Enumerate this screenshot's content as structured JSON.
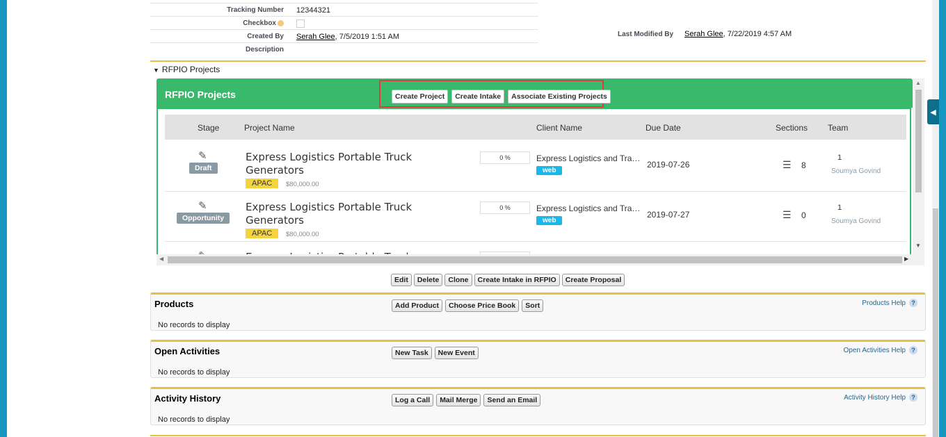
{
  "detail": {
    "tracking_label": "Tracking Number",
    "tracking_value": "12344321",
    "checkbox_label": "Checkbox",
    "created_by_label": "Created By",
    "created_by_user": "Serah Glee",
    "created_by_date": ", 7/5/2019 1:51 AM",
    "description_label": "Description",
    "last_modified_label": "Last Modified By",
    "last_modified_user": "Serah Glee",
    "last_modified_date": ", 7/22/2019 4:57 AM"
  },
  "rfpio_section": {
    "toggle_label": "RFPIO Projects",
    "panel_title": "RFPIO Projects",
    "buttons": [
      "Create Project",
      "Create Intake",
      "Associate Existing Projects"
    ],
    "columns": [
      "Stage",
      "Project Name",
      "Client Name",
      "Due Date",
      "Sections",
      "Team"
    ],
    "rows": [
      {
        "stage": "Draft",
        "project_name": "Express Logistics Portable Truck Generators",
        "region": "APAC",
        "amount": "$80,000.00",
        "progress": "0 %",
        "client": "Express Logistics and Transport",
        "client_tag": "web",
        "due_date": "2019-07-26",
        "sections": "8",
        "team_count": "1",
        "team_member": "Soumya Govind"
      },
      {
        "stage": "Opportunity",
        "project_name": "Express Logistics Portable Truck Generators",
        "region": "APAC",
        "amount": "$80,000.00",
        "progress": "0 %",
        "client": "Express Logistics and Transport",
        "client_tag": "web",
        "due_date": "2019-07-27",
        "sections": "0",
        "team_count": "1",
        "team_member": "Soumya Govind"
      },
      {
        "project_name": "Express Logistics Portable Truck"
      }
    ]
  },
  "actions": [
    "Edit",
    "Delete",
    "Clone",
    "Create Intake in RFPIO",
    "Create Proposal"
  ],
  "related_lists": [
    {
      "title": "Products",
      "buttons": [
        "Add Product",
        "Choose Price Book",
        "Sort"
      ],
      "help": "Products Help",
      "empty": "No records to display"
    },
    {
      "title": "Open Activities",
      "buttons": [
        "New Task",
        "New Event"
      ],
      "help": "Open Activities Help",
      "empty": "No records to display"
    },
    {
      "title": "Activity History",
      "buttons": [
        "Log a Call",
        "Mail Merge",
        "Send an Email"
      ],
      "help": "Activity History Help",
      "empty": "No records to display"
    }
  ],
  "colors": {
    "accent_green": "#39b96b",
    "frame_blue": "#1797c0",
    "highlight_red": "#e03c3c",
    "section_gold": "#e8bf3c"
  }
}
